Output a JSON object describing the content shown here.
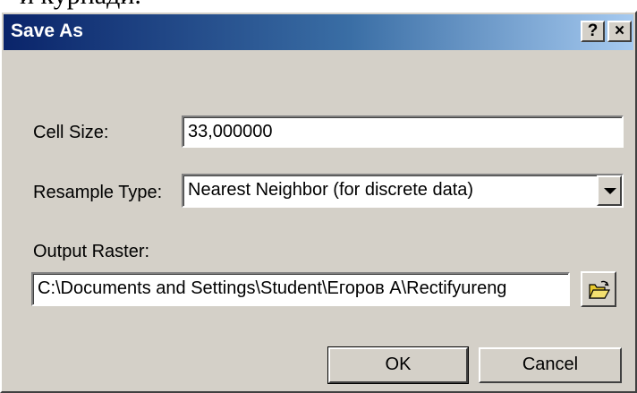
{
  "background_text": "и курнади.",
  "window": {
    "title": "Save As",
    "help_label": "?",
    "close_label": "×"
  },
  "form": {
    "cell_size_label": "Cell Size:",
    "cell_size_value": "33,000000",
    "resample_label": "Resample Type:",
    "resample_value": "Nearest Neighbor (for discrete data)",
    "output_label": "Output Raster:",
    "output_value": "C:\\Documents and Settings\\Student\\Егоров А\\Rectifyureng"
  },
  "buttons": {
    "ok": "OK",
    "cancel": "Cancel"
  },
  "icons": {
    "browse": "open-folder-icon",
    "dropdown": "chevron-down-icon"
  },
  "colors": {
    "titlebar_start": "#0a246a",
    "titlebar_end": "#a6caf0",
    "dialog_face": "#d4d0c8",
    "folder_yellow": "#e8c82c"
  }
}
